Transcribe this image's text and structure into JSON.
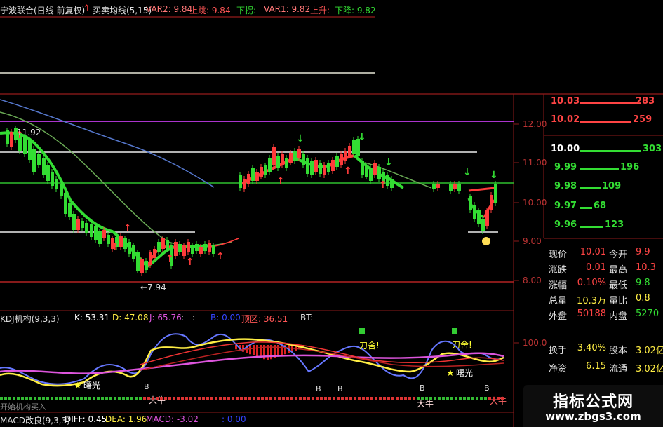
{
  "header": {
    "stock_title": "宁波联合(日线 前复权)",
    "indicator_name": "买卖均线(5,15)",
    "var2": "VAR2: 9.84",
    "up_jump": "上跳: 9.84",
    "down_break": "下拐: -",
    "var1": "VAR1: 9.82",
    "rise": "上升: -",
    "fall": "下降: 9.82"
  },
  "price_axis": [
    "12.00",
    "11.00",
    "10.00",
    "9.00",
    "8.00"
  ],
  "annotations": {
    "high_label": "11.92",
    "low_label": "←7.94"
  },
  "kdj_header": {
    "name": "KDJ机构(9,3,3)",
    "k": "K: 53.31",
    "d": "D: 47.08",
    "j": "J: 65.76",
    "dashes": ": - : -",
    "b": "B: 0.00",
    "top_zone": "顶区: 36.51",
    "bt": "BT: -"
  },
  "kdj_axis": [
    "100.0"
  ],
  "kdj_labels": {
    "dawn1": "曙光",
    "dawn2": "曙光",
    "knife1": "刀舍!",
    "knife2": "刀舍!",
    "bull1": "大牛",
    "bull2": "大牛",
    "bull3": "大牛",
    "b": "B"
  },
  "macd_header": {
    "name": "MACD改良(9,3,3)",
    "diff": "DIFF: 0.45",
    "dea": "DEA: 1.96",
    "macd": "MACD: -3.02",
    "zero": ": 0.00"
  },
  "bottom_text": "开始机构买入",
  "order_book": {
    "asks": [
      {
        "price": "10.03",
        "vol": "283"
      },
      {
        "price": "10.02",
        "vol": "259"
      }
    ],
    "bids": [
      {
        "price": "10.00",
        "vol": "303"
      },
      {
        "price": "9.99",
        "vol": "196"
      },
      {
        "price": "9.98",
        "vol": "109"
      },
      {
        "price": "9.97",
        "vol": "68"
      },
      {
        "price": "9.96",
        "vol": "123"
      }
    ]
  },
  "quote": {
    "rows": [
      {
        "l1": "现价",
        "v1": "10.01",
        "l2": "今开",
        "v2": "9.9"
      },
      {
        "l1": "涨跌",
        "v1": "0.01",
        "l2": "最高",
        "v2": "10.3"
      },
      {
        "l1": "涨幅",
        "v1": "0.10%",
        "l2": "最低",
        "v2": "9.8"
      },
      {
        "l1": "总量",
        "v1": "10.3万",
        "l2": "量比",
        "v2": "0.8"
      },
      {
        "l1": "外盘",
        "v1": "50188",
        "l2": "内盘",
        "v2": "5270"
      },
      {
        "l1": "换手",
        "v1": "3.40%",
        "l2": "股本",
        "v2": "3.02亿"
      },
      {
        "l1": "净资",
        "v1": "6.15",
        "l2": "流通",
        "v2": "3.02亿"
      }
    ]
  },
  "watermark": {
    "title": "指标公式网",
    "url": "www.zbgs3.com"
  },
  "colors": {
    "up": "#ff3b3b",
    "down": "#33dd33",
    "yellow": "#ffff33",
    "magenta": "#cc44cc",
    "axis": "#8b1a1a"
  }
}
